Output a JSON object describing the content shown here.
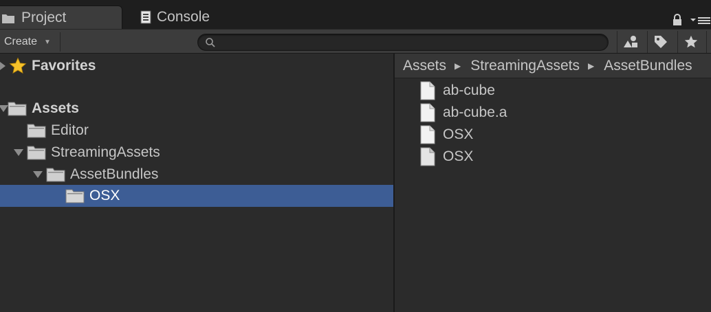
{
  "tabs": [
    {
      "label": "Project",
      "icon": "folder-icon",
      "active": true
    },
    {
      "label": "Console",
      "icon": "console-icon",
      "active": false
    }
  ],
  "toolbar": {
    "create_label": "Create",
    "search": {
      "value": "",
      "placeholder": ""
    }
  },
  "tree": {
    "favorites_label": "Favorites",
    "assets_label": "Assets",
    "items": [
      {
        "label": "Editor"
      },
      {
        "label": "StreamingAssets"
      },
      {
        "label": "AssetBundles"
      },
      {
        "label": "OSX",
        "selected": true
      }
    ]
  },
  "breadcrumb": [
    "Assets",
    "StreamingAssets",
    "AssetBundles"
  ],
  "files": [
    {
      "label": "ab-cube",
      "icon": "file-icon"
    },
    {
      "label": "ab-cube.a",
      "icon": "file-icon"
    },
    {
      "label": "OSX",
      "icon": "file-icon"
    },
    {
      "label": "OSX",
      "icon": "manifest-file-icon"
    }
  ],
  "colors": {
    "selection": "#3d5d95",
    "panel": "#2b2b2b",
    "toolbar": "#3c3c3c",
    "star": "#f5c12a"
  }
}
